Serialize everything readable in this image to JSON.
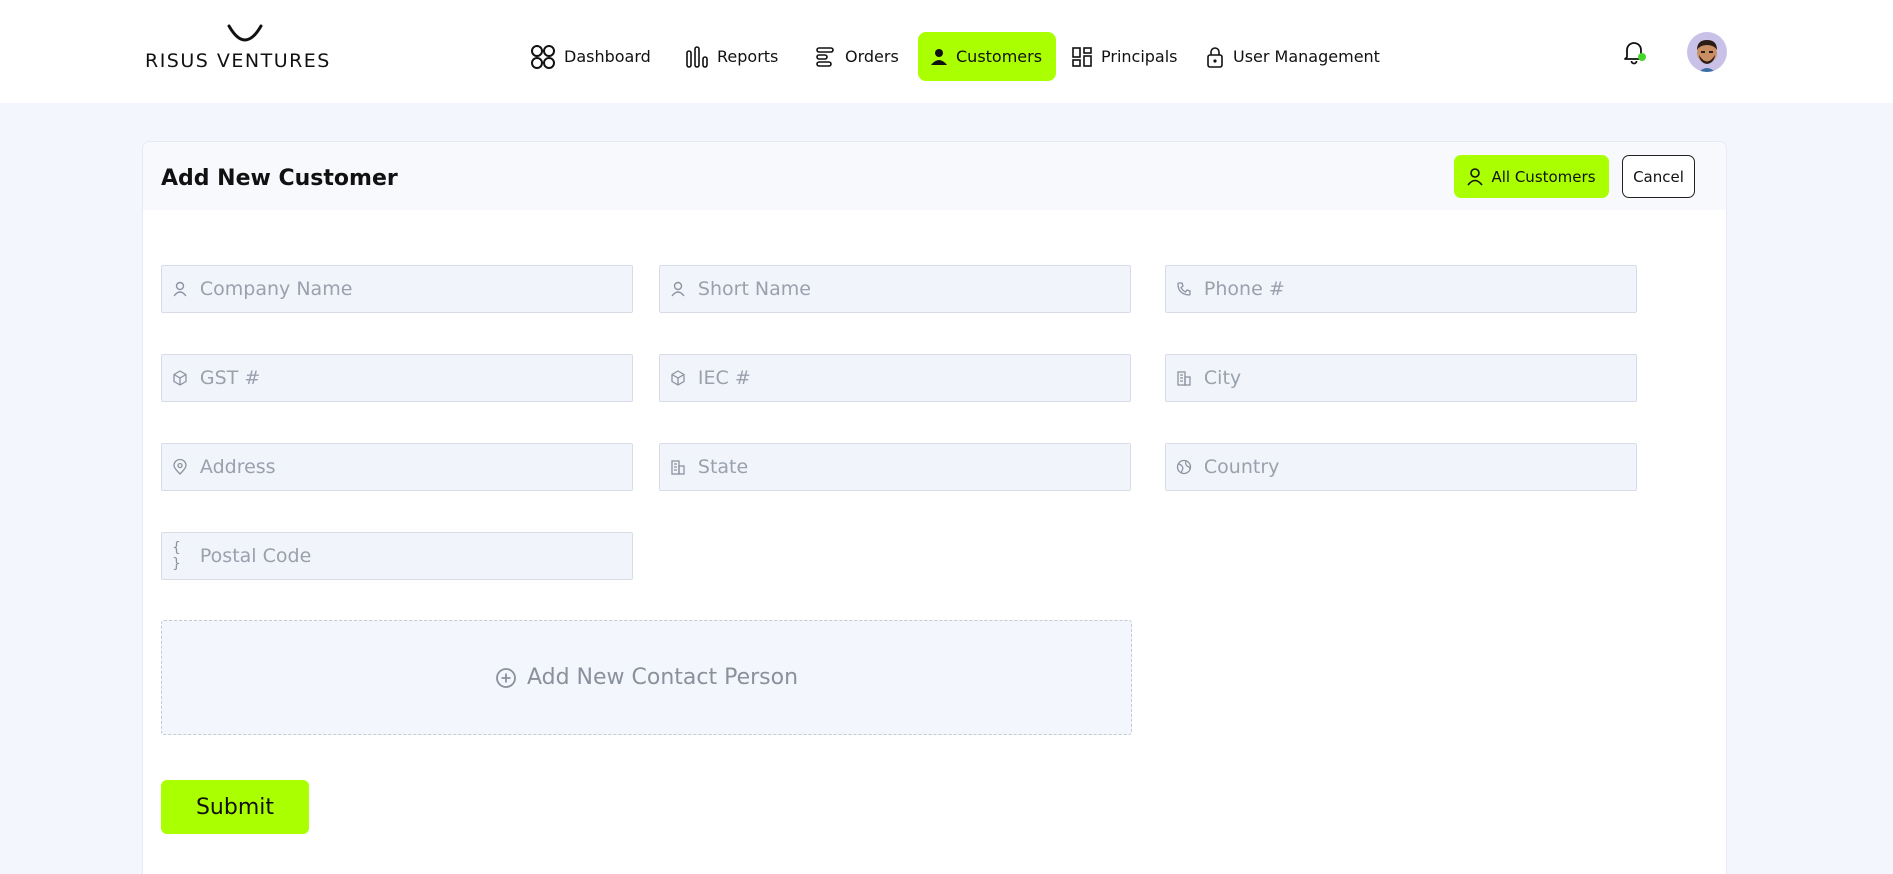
{
  "brand": {
    "name": "RISUS VENTURES"
  },
  "nav": {
    "items": [
      {
        "label": "Dashboard",
        "icon": "dashboard-icon"
      },
      {
        "label": "Reports",
        "icon": "reports-icon"
      },
      {
        "label": "Orders",
        "icon": "orders-icon"
      },
      {
        "label": "Customers",
        "icon": "customer-icon",
        "active": true
      },
      {
        "label": "Principals",
        "icon": "principals-icon"
      },
      {
        "label": "User Management",
        "icon": "lock-icon"
      }
    ]
  },
  "header": {
    "notification_icon": "bell-icon",
    "avatar_icon": "user-avatar"
  },
  "page": {
    "title": "Add New Customer",
    "all_customers_label": "All Customers",
    "cancel_label": "Cancel"
  },
  "form": {
    "company_name": {
      "placeholder": "Company Name",
      "icon": "user-icon"
    },
    "short_name": {
      "placeholder": "Short Name",
      "icon": "user-icon"
    },
    "phone": {
      "placeholder": "Phone #",
      "icon": "phone-icon"
    },
    "gst": {
      "placeholder": "GST #",
      "icon": "box-icon"
    },
    "iec": {
      "placeholder": "IEC #",
      "icon": "box-icon"
    },
    "city": {
      "placeholder": "City",
      "icon": "building-icon"
    },
    "address": {
      "placeholder": "Address",
      "icon": "location-pin-icon"
    },
    "state": {
      "placeholder": "State",
      "icon": "building-icon"
    },
    "country": {
      "placeholder": "Country",
      "icon": "globe-icon"
    },
    "postal_code": {
      "placeholder": "Postal Code",
      "icon": "braces-icon"
    },
    "add_contact_label": "Add New Contact Person",
    "submit_label": "Submit"
  },
  "colors": {
    "accent": "#aaff00",
    "background": "#f3f6fd",
    "field_bg": "#f1f4fb",
    "notification_dot": "#44d62c"
  }
}
